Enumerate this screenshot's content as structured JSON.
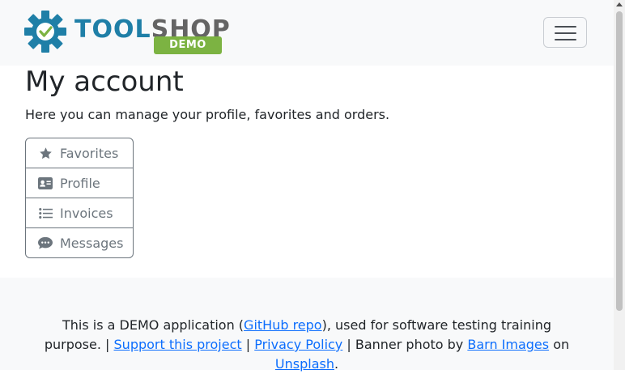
{
  "brand": {
    "word_part1": "TOOL",
    "word_part2": "SHOP",
    "badge": "DEMO",
    "icon": "gear-check-icon",
    "colors": {
      "blue": "#1f7fa7",
      "gray": "#646464",
      "green": "#7cb342"
    }
  },
  "navbar": {
    "toggle_icon": "hamburger-icon"
  },
  "page": {
    "title": "My account",
    "lead": "Here you can manage your profile, favorites and orders."
  },
  "menu": {
    "items": [
      {
        "label": "Favorites",
        "icon": "star-icon"
      },
      {
        "label": "Profile",
        "icon": "id-card-icon"
      },
      {
        "label": "Invoices",
        "icon": "list-icon"
      },
      {
        "label": "Messages",
        "icon": "comment-icon"
      }
    ]
  },
  "footer": {
    "text1": "This is a DEMO application (",
    "link_github": "GitHub repo",
    "text2": "), used for software testing training purpose. | ",
    "link_support": "Support this project",
    "sep1": " | ",
    "link_privacy": "Privacy Policy",
    "text3": " | Banner photo by ",
    "link_barn": "Barn Images",
    "text4": " on ",
    "link_unsplash": "Unsplash",
    "text5": "."
  }
}
